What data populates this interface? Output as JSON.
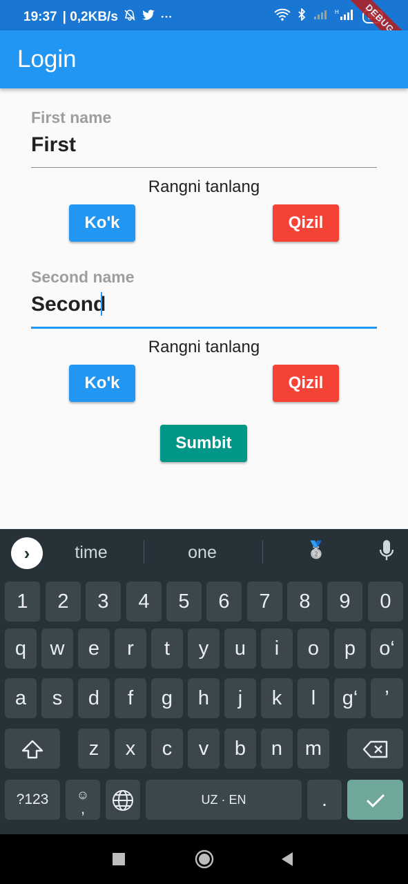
{
  "status_bar": {
    "time": "19:37",
    "speed": "| 0,2KB/s",
    "battery": "53",
    "network_label": "H"
  },
  "debug_banner": "DEBUG",
  "app_bar": {
    "title": "Login"
  },
  "form": {
    "first": {
      "label": "First name",
      "value": "First",
      "section_label": "Rangni tanlang",
      "blue_button": "Ko'k",
      "red_button": "Qizil"
    },
    "second": {
      "label": "Second name",
      "value": "Second",
      "section_label": "Rangni tanlang",
      "blue_button": "Ko'k",
      "red_button": "Qizil"
    },
    "submit_button": "Sumbit"
  },
  "keyboard": {
    "suggestions": [
      "time",
      "one"
    ],
    "emoji_medal": "🥈",
    "numbers": [
      "1",
      "2",
      "3",
      "4",
      "5",
      "6",
      "7",
      "8",
      "9",
      "0"
    ],
    "row1": [
      "q",
      "w",
      "e",
      "r",
      "t",
      "y",
      "u",
      "i",
      "o",
      "p",
      "o‘"
    ],
    "row2": [
      "a",
      "s",
      "d",
      "f",
      "g",
      "h",
      "j",
      "k",
      "l",
      "g‘",
      "’"
    ],
    "row3": [
      "z",
      "x",
      "c",
      "v",
      "b",
      "n",
      "m"
    ],
    "symbols_key": "?123",
    "emoji_key": "☺",
    "comma_key": ",",
    "space_label": "UZ · EN",
    "period_key": ".",
    "enter_icon": "check-icon"
  },
  "colors": {
    "status_bar": "#1976d2",
    "app_bar": "#2196f3",
    "blue_button": "#2196f3",
    "red_button": "#f44336",
    "submit_button": "#009688",
    "keyboard_bg": "#263238"
  }
}
